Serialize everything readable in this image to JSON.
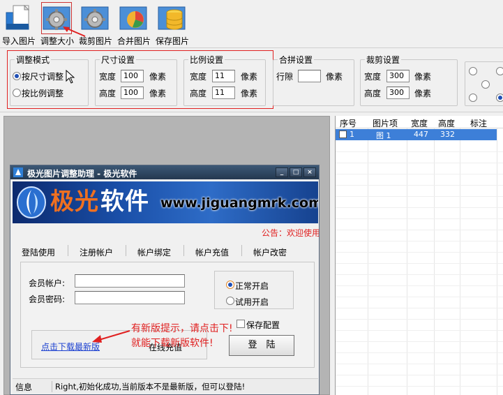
{
  "toolbar": {
    "items": [
      {
        "label": "导入图片",
        "icon": "import-image-icon"
      },
      {
        "label": "调整大小",
        "icon": "resize-gear-icon"
      },
      {
        "label": "裁剪图片",
        "icon": "crop-gear-icon"
      },
      {
        "label": "合并图片",
        "icon": "merge-pie-icon"
      },
      {
        "label": "保存图片",
        "icon": "save-database-icon"
      }
    ]
  },
  "settings": {
    "mode": {
      "title": "调整模式",
      "by_size": "按尺寸调整",
      "by_ratio": "按比例调整"
    },
    "size": {
      "title": "尺寸设置",
      "width_label": "宽度",
      "width_value": "100",
      "height_label": "高度",
      "height_value": "100",
      "unit": "像素"
    },
    "ratio": {
      "title": "比例设置",
      "width_label": "宽度",
      "width_value": "11",
      "height_label": "高度",
      "height_value": "11",
      "unit": "像素"
    },
    "merge": {
      "title": "合拼设置",
      "gap_label": "行隙",
      "gap_value": "",
      "unit": "像素"
    },
    "crop": {
      "title": "裁剪设置",
      "width_label": "宽度",
      "width_value": "300",
      "height_label": "高度",
      "height_value": "300",
      "unit": "像素"
    }
  },
  "table": {
    "headers": [
      "序号",
      "图片项",
      "宽度",
      "高度",
      "标注"
    ],
    "rows": [
      {
        "index": "1",
        "item": "图 1",
        "width": "447",
        "height": "332",
        "note": ""
      }
    ]
  },
  "dialog": {
    "title": "极光图片调整助理 - 极光软件",
    "window_buttons": {
      "minimize": "_",
      "maximize": "□",
      "close": "×"
    },
    "banner": {
      "brand_a": "极光",
      "brand_b": "软件",
      "url": "www.jiguangmrk.com"
    },
    "notice": "公告：欢迎使用",
    "tabs": [
      "登陆使用",
      "注册帐户",
      "帐户绑定",
      "帐户充值",
      "帐户改密"
    ],
    "account_label": "会员帐户:",
    "account_value": "",
    "password_label": "会员密码:",
    "password_value": "",
    "mode_normal": "正常开启",
    "mode_trial": "试用开启",
    "save_config": "保存配置",
    "download_link": "点击下载最新版",
    "online_recharge": "在线充值",
    "login_button": "登　陆",
    "status_label": "信息",
    "status_text": "Right,初始化成功,当前版本不是最新版，但可以登陆!"
  },
  "annotation": {
    "line1": "有新版提示，请点击下!",
    "line2": "就能下载新版软件!"
  },
  "colors": {
    "annotation_red": "#e02020",
    "selection_blue": "#3d7fd8",
    "title_bar": "#2c4560",
    "link_blue": "#1a3fd0"
  }
}
